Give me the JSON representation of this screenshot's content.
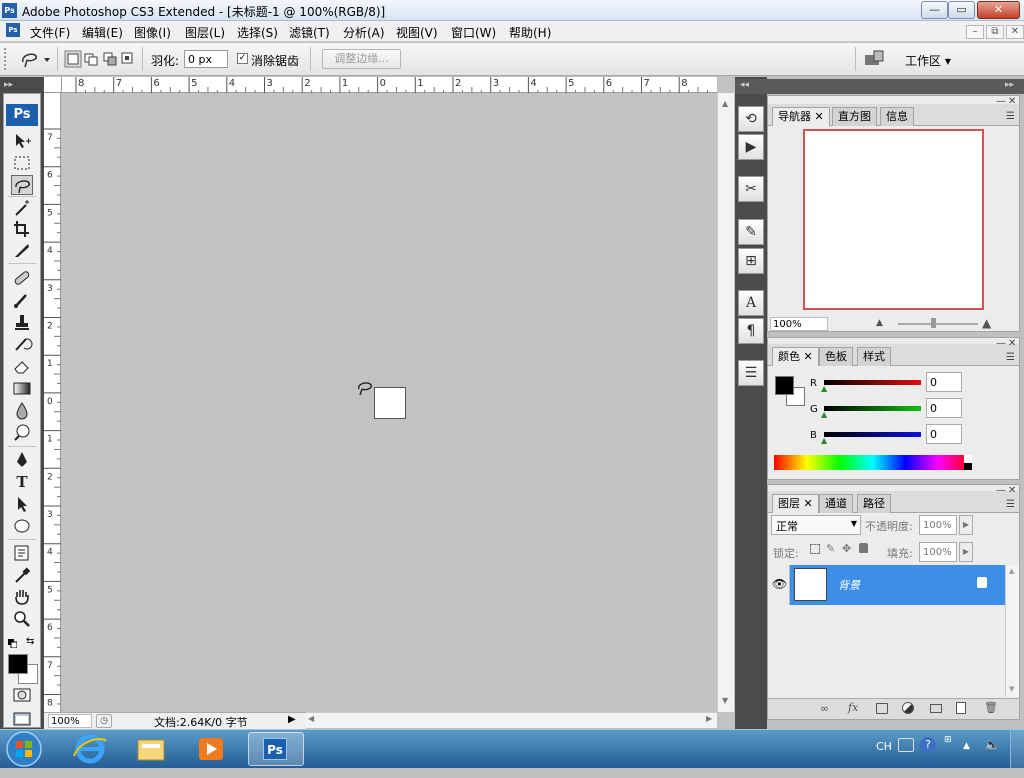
{
  "titlebar": {
    "ps_logo": "Ps",
    "title": "Adobe Photoshop CS3 Extended - [未标题-1 @ 100%(RGB/8)]",
    "minimize": "—",
    "maximize": "▭",
    "close": "✕"
  },
  "menubar": {
    "items": [
      "文件(F)",
      "编辑(E)",
      "图像(I)",
      "图层(L)",
      "选择(S)",
      "滤镜(T)",
      "分析(A)",
      "视图(V)",
      "窗口(W)",
      "帮助(H)"
    ],
    "doc_min": "–",
    "doc_restore": "⧉",
    "doc_close": "✕"
  },
  "options": {
    "feather_label": "羽化:",
    "feather_value": "0 px",
    "antialias_label": "消除锯齿",
    "antialias_checked": true,
    "refine_edge_label": "调整边缘...",
    "workspace_label": "工作区 ▾"
  },
  "toolbox": {
    "logo": "Ps"
  },
  "rulers": {
    "top_ticks": [
      "8",
      "7",
      "6",
      "5",
      "4",
      "3",
      "2",
      "1",
      "0",
      "1",
      "2",
      "3",
      "4",
      "5",
      "6",
      "7",
      "8"
    ],
    "left_ticks": [
      "7",
      "6",
      "5",
      "4",
      "3",
      "2",
      "1",
      "0",
      "1",
      "2",
      "3",
      "4",
      "5",
      "6",
      "7",
      "8"
    ]
  },
  "status": {
    "zoom": "100%",
    "doc_info": "文档:2.64K/0 字节"
  },
  "navigator_panel": {
    "tabs": [
      "导航器",
      "直方图",
      "信息"
    ],
    "zoom": "100%"
  },
  "color_panel": {
    "tabs": [
      "颜色",
      "色板",
      "样式"
    ],
    "channels": [
      {
        "label": "R",
        "value": "0",
        "color": "#e01010"
      },
      {
        "label": "G",
        "value": "0",
        "color": "#10c010"
      },
      {
        "label": "B",
        "value": "0",
        "color": "#1010e0"
      }
    ]
  },
  "layers_panel": {
    "tabs": [
      "图层",
      "通道",
      "路径"
    ],
    "blend_mode": "正常",
    "opacity_label": "不透明度:",
    "opacity_value": "100%",
    "lock_label": "锁定:",
    "fill_label": "填充:",
    "fill_value": "100%",
    "layers": [
      {
        "name": "背景",
        "selected": true
      }
    ]
  },
  "taskbar": {
    "lang": "CH",
    "apps": [
      "Internet Explorer",
      "Windows Explorer",
      "Windows Media Player",
      "Ps"
    ]
  }
}
